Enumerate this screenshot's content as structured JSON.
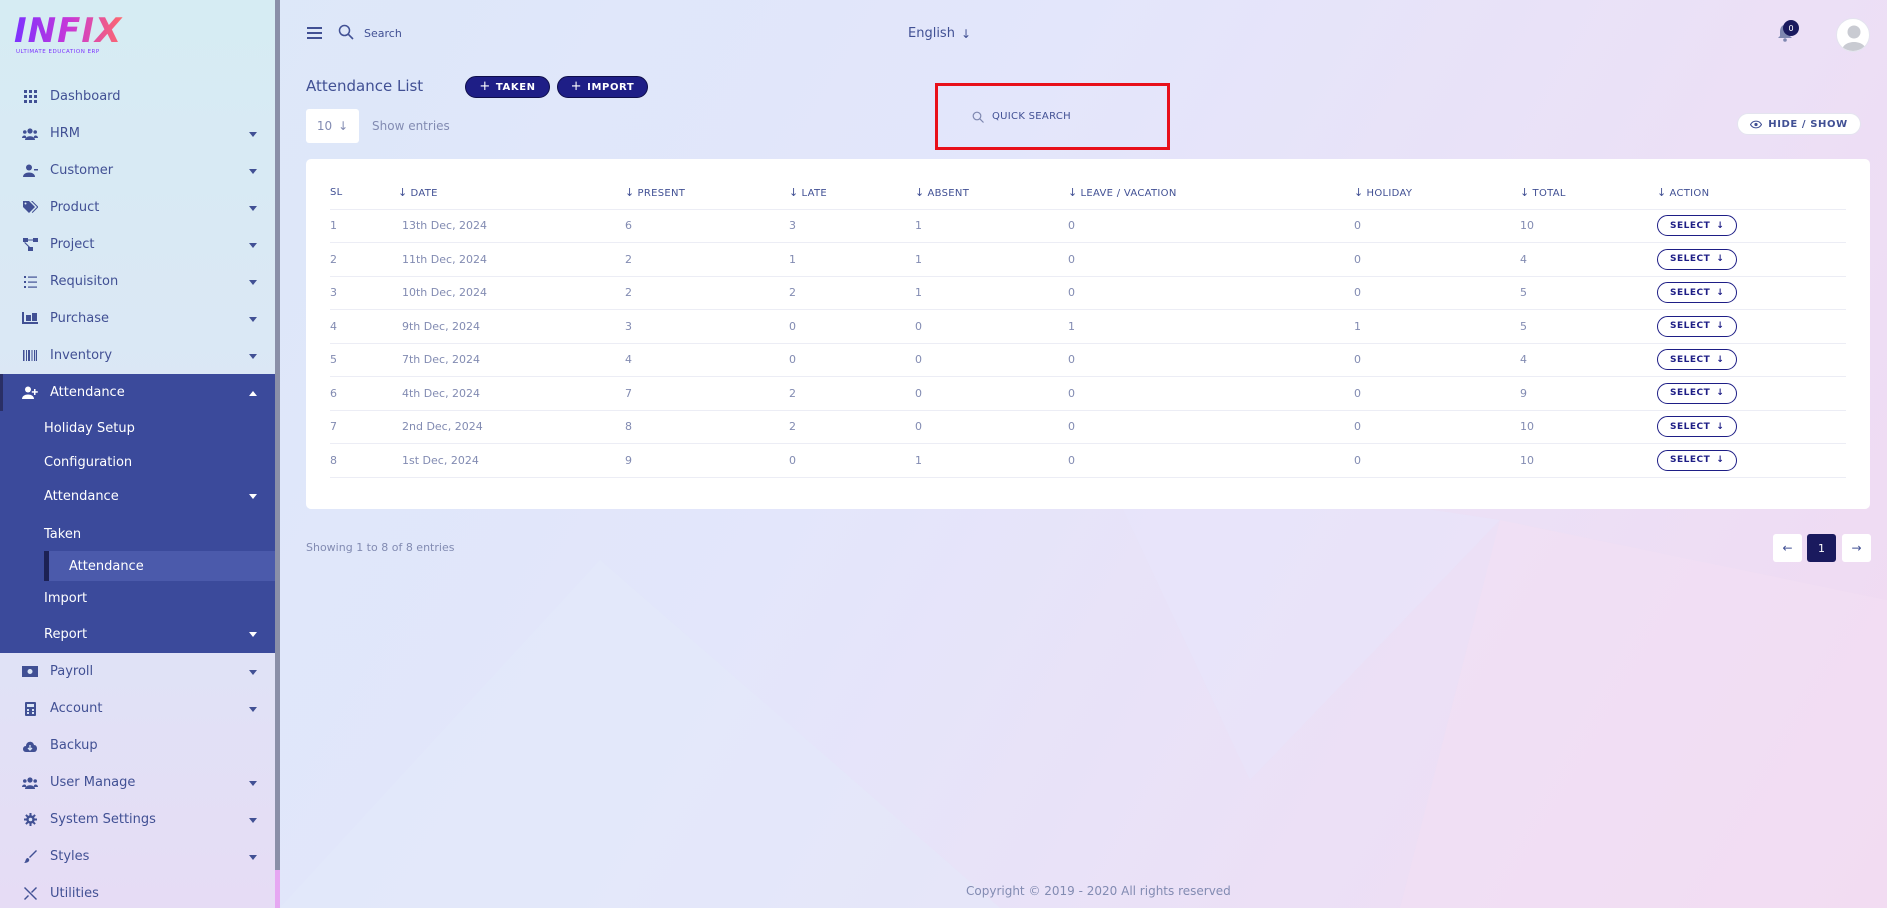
{
  "app": {
    "logo_text": "INFIX",
    "logo_subtitle": "ULTIMATE EDUCATION ERP"
  },
  "sidebar": {
    "items": [
      {
        "label": "Dashboard",
        "icon": "grid-icon"
      },
      {
        "label": "HRM",
        "icon": "users-icon"
      },
      {
        "label": "Customer",
        "icon": "user-icon"
      },
      {
        "label": "Product",
        "icon": "tags-icon"
      },
      {
        "label": "Project",
        "icon": "project-diagram-icon"
      },
      {
        "label": "Requisiton",
        "icon": "list-icon"
      },
      {
        "label": "Purchase",
        "icon": "dolly-icon"
      },
      {
        "label": "Inventory",
        "icon": "barcode-icon"
      },
      {
        "label": "Attendance",
        "icon": "user-plus-icon"
      }
    ],
    "attendance_sub": {
      "holiday_setup": "Holiday Setup",
      "configuration": "Configuration",
      "attendance": "Attendance",
      "taken": "Taken",
      "attendance_child": "Attendance",
      "import": "Import",
      "report": "Report"
    },
    "items_after": [
      {
        "label": "Payroll",
        "icon": "money-icon"
      },
      {
        "label": "Account",
        "icon": "calculator-icon"
      },
      {
        "label": "Backup",
        "icon": "cloud-download-icon"
      },
      {
        "label": "User Manage",
        "icon": "users-icon"
      },
      {
        "label": "System Settings",
        "icon": "gear-icon"
      },
      {
        "label": "Styles",
        "icon": "brush-icon"
      },
      {
        "label": "Utilities",
        "icon": "tools-icon"
      }
    ]
  },
  "header": {
    "search_placeholder": "Search",
    "language": "English",
    "notification_count": "0"
  },
  "main": {
    "title": "Attendance List",
    "taken_button": "TAKEN",
    "import_button": "IMPORT",
    "entries_value": "10",
    "entries_label": "Show entries",
    "quick_search_placeholder": "QUICK SEARCH",
    "hide_show_label": "HIDE / SHOW",
    "columns": [
      "SL",
      "DATE",
      "PRESENT",
      "LATE",
      "ABSENT",
      "LEAVE / VACATION",
      "HOLIDAY",
      "TOTAL",
      "ACTION"
    ],
    "rows": [
      [
        "1",
        "13th Dec, 2024",
        "6",
        "3",
        "1",
        "0",
        "0",
        "10"
      ],
      [
        "2",
        "11th Dec, 2024",
        "2",
        "1",
        "1",
        "0",
        "0",
        "4"
      ],
      [
        "3",
        "10th Dec, 2024",
        "2",
        "2",
        "1",
        "0",
        "0",
        "5"
      ],
      [
        "4",
        "9th Dec, 2024",
        "3",
        "0",
        "0",
        "1",
        "1",
        "5"
      ],
      [
        "5",
        "7th Dec, 2024",
        "4",
        "0",
        "0",
        "0",
        "0",
        "4"
      ],
      [
        "6",
        "4th Dec, 2024",
        "7",
        "2",
        "0",
        "0",
        "0",
        "9"
      ],
      [
        "7",
        "2nd Dec, 2024",
        "8",
        "2",
        "0",
        "0",
        "0",
        "10"
      ],
      [
        "8",
        "1st Dec, 2024",
        "9",
        "0",
        "1",
        "0",
        "0",
        "10"
      ]
    ],
    "select_label": "SELECT",
    "showing_text": "Showing 1 to 8 of 8 entries",
    "current_page": "1"
  },
  "footer": {
    "copyright": "Copyright © 2019 - 2020 All rights reserved"
  },
  "colors": {
    "primary_dark": "#1e1e86",
    "sidebar_active": "#3b4a9b",
    "text": "#415094",
    "muted": "#828bb2",
    "highlight_box": "#e8101a"
  }
}
